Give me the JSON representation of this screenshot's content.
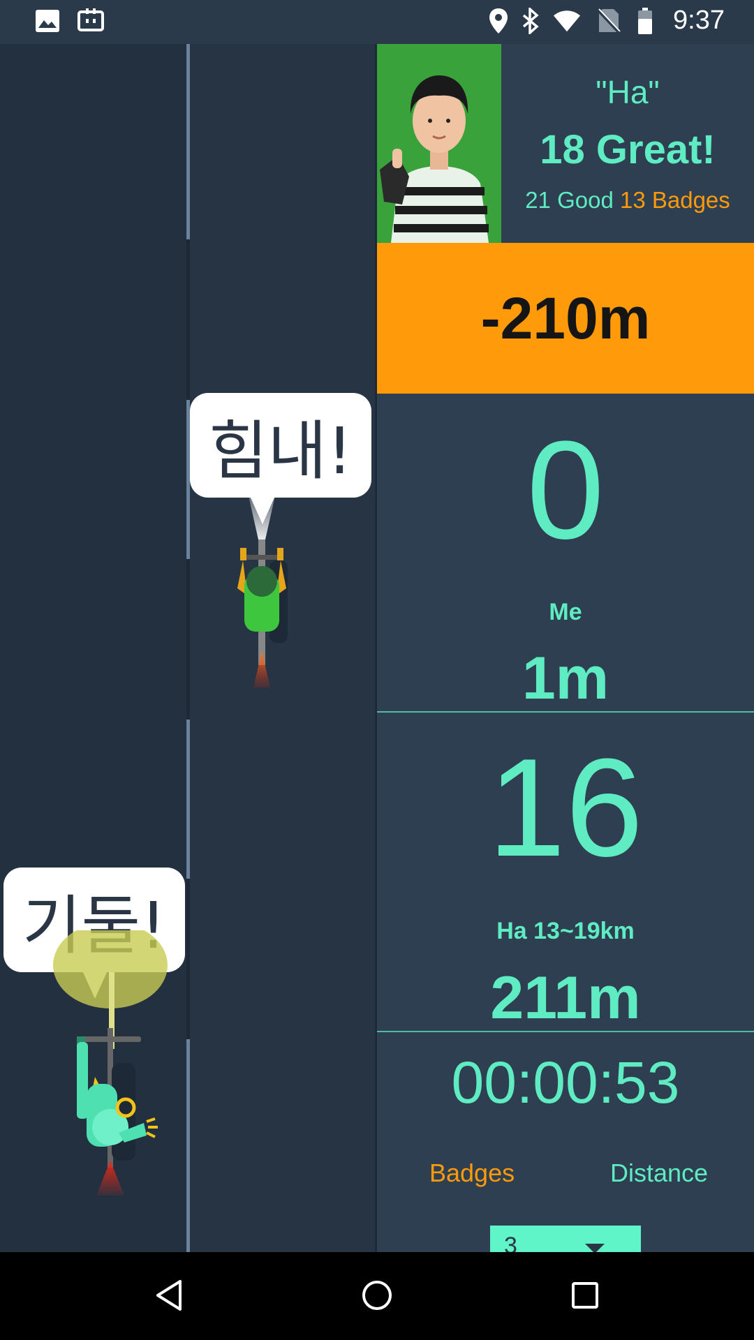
{
  "status_bar": {
    "time": "9:37",
    "icons_left": [
      "image-icon",
      "cast-icon"
    ],
    "icons_right": [
      "location-icon",
      "bluetooth-icon",
      "wifi-icon",
      "no-sim-icon",
      "battery-icon"
    ]
  },
  "road": {
    "rider_front_bubble": "힘내!",
    "rider_back_bubble": "기둘!"
  },
  "profile": {
    "name": "\"Ha\"",
    "great": "18 Great!",
    "good": "21 Good",
    "badges": "13 Badges"
  },
  "gap_banner": "-210m",
  "me": {
    "speed": "0",
    "label": "Me",
    "distance": "1m"
  },
  "rival": {
    "speed": "16",
    "label": "Ha 13~19km",
    "distance": "211m"
  },
  "timer": "00:00:53",
  "tabs": {
    "badges": "Badges",
    "distance": "Distance"
  },
  "selector": {
    "value": "3"
  },
  "colors": {
    "accent": "#5fecc2",
    "orange": "#ff9a0a",
    "panel": "#2d3f50",
    "road": "#263443"
  }
}
